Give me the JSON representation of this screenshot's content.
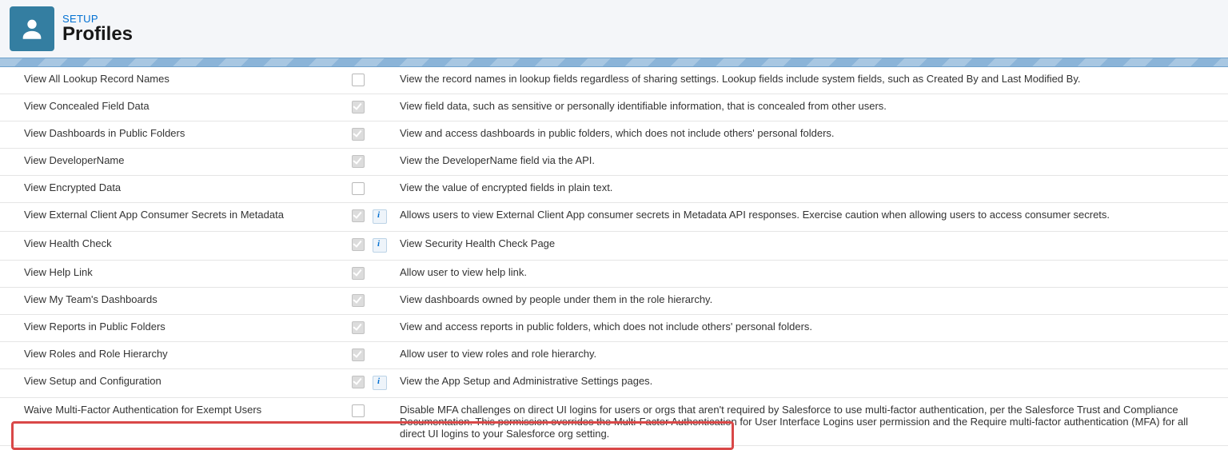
{
  "header": {
    "breadcrumb": "SETUP",
    "title": "Profiles"
  },
  "rows": [
    {
      "label": "View All Lookup Record Names",
      "checked": false,
      "info": false,
      "desc": "View the record names in lookup fields regardless of sharing settings. Lookup fields include system fields, such as Created By and Last Modified By."
    },
    {
      "label": "View Concealed Field Data",
      "checked": true,
      "info": false,
      "desc": "View field data, such as sensitive or personally identifiable information, that is concealed from other users."
    },
    {
      "label": "View Dashboards in Public Folders",
      "checked": true,
      "info": false,
      "desc": "View and access dashboards in public folders, which does not include others' personal folders."
    },
    {
      "label": "View DeveloperName",
      "checked": true,
      "info": false,
      "desc": "View the DeveloperName field via the API."
    },
    {
      "label": "View Encrypted Data",
      "checked": false,
      "info": false,
      "desc": "View the value of encrypted fields in plain text."
    },
    {
      "label": "View External Client App Consumer Secrets in Metadata",
      "checked": true,
      "info": true,
      "desc": "Allows users to view External Client App consumer secrets in Metadata API responses. Exercise caution when allowing users to access consumer secrets."
    },
    {
      "label": "View Health Check",
      "checked": true,
      "info": true,
      "desc": "View Security Health Check Page"
    },
    {
      "label": "View Help Link",
      "checked": true,
      "info": false,
      "desc": "Allow user to view help link."
    },
    {
      "label": "View My Team's Dashboards",
      "checked": true,
      "info": false,
      "desc": "View dashboards owned by people under them in the role hierarchy."
    },
    {
      "label": "View Reports in Public Folders",
      "checked": true,
      "info": false,
      "desc": "View and access reports in public folders, which does not include others' personal folders."
    },
    {
      "label": "View Roles and Role Hierarchy",
      "checked": true,
      "info": false,
      "desc": "Allow user to view roles and role hierarchy."
    },
    {
      "label": "View Setup and Configuration",
      "checked": true,
      "info": true,
      "highlighted": true,
      "desc": "View the App Setup and Administrative Settings pages."
    },
    {
      "label": "Waive Multi-Factor Authentication for Exempt Users",
      "checked": false,
      "info": false,
      "desc": "Disable MFA challenges on direct UI logins for users or orgs that aren't required by Salesforce to use multi-factor authentication, per the Salesforce Trust and Compliance Documentation. This permission overrides the Multi-Factor Authentication for User Interface Logins user permission and the Require multi-factor authentication (MFA) for all direct UI logins to your Salesforce org setting."
    }
  ]
}
